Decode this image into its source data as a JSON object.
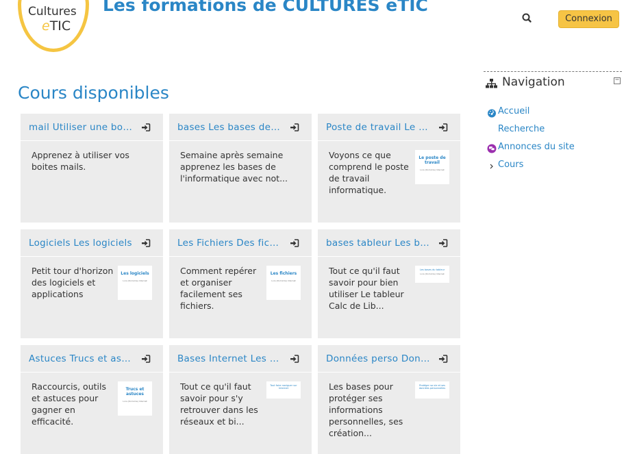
{
  "header": {
    "logo_line1": "Cultures",
    "logo_line2_e": "e",
    "logo_line2_rest": "TIC",
    "site_title": "Les formations de CULTURES eTIC",
    "login_label": "Connexion",
    "search_icon": "search-icon"
  },
  "main": {
    "title": "Cours disponibles",
    "courses": [
      {
        "title": "mail Utiliser une boite mail",
        "summary": "Apprenez à utiliser vos boites mails.",
        "thumb": null
      },
      {
        "title": "bases Les bases de l'informatique",
        "summary": "Semaine après semaine apprenez les bases de l'informatique avec not...",
        "thumb": null
      },
      {
        "title": "Poste de travail Le poste de travail",
        "summary": "Voyons ce que comprend le poste de travail informatique.",
        "thumb": {
          "title": "Le poste de travail",
          "sub": "Lors (Domicile) Internet"
        }
      },
      {
        "title": "Logiciels Les logiciels",
        "summary": "Petit tour d'horizon des logiciels et applications",
        "thumb": {
          "title": "Les logiciels",
          "sub": "Lors (Domicile) Internet"
        }
      },
      {
        "title": "Les Fichiers Des fichiers",
        "summary": "Comment repérer et organiser facilement ses fichiers.",
        "thumb": {
          "title": "Les fichiers",
          "sub": "Lors (Domicile) Internet"
        }
      },
      {
        "title": "bases tableur Les bases du tableur",
        "summary": "Tout ce qu'il faut savoir pour bien utiliser Le tableur Calc de Lib...",
        "thumb": {
          "title": "Les bases du tableur",
          "sub": "Lors (Domicile) Internet",
          "small": true
        }
      },
      {
        "title": "Astuces Trucs et astuces",
        "summary": "Raccourcis, outils et astuces pour gagner en efficacité.",
        "thumb": {
          "title": "Trucs et astuces",
          "sub": "Lors (Domicile) Internet"
        }
      },
      {
        "title": "Bases Internet Les bases d'Internet",
        "summary": "Tout ce qu'il faut savoir pour s'y retrouver dans les réseaux et bi...",
        "thumb": {
          "title": "Tout faire naviguer sur Internet",
          "sub": "",
          "small": true
        }
      },
      {
        "title": "Données perso Données personnelles",
        "summary": "Les bases pour protéger ses informations personnelles, ses création...",
        "thumb": {
          "title": "Protéger sa vie et ses données personnelles",
          "sub": "",
          "small": true
        }
      }
    ]
  },
  "sidebar": {
    "title": "Navigation",
    "items": [
      {
        "label": "Accueil",
        "icon": "dashboard-icon"
      },
      {
        "label": "Recherche",
        "icon": ""
      },
      {
        "label": "Annonces du site",
        "icon": "forum-icon"
      },
      {
        "label": "Cours",
        "icon": "chevron-right-icon"
      }
    ]
  },
  "colors": {
    "accent": "#2a86c6",
    "button": "#f6c445",
    "card": "#ececec"
  }
}
